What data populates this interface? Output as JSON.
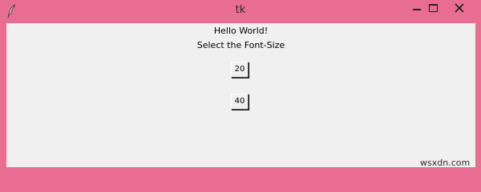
{
  "window": {
    "title": "tk"
  },
  "labels": {
    "greeting": "Hello World!",
    "prompt": "Select the Font-Size"
  },
  "buttons": {
    "size_20": "20",
    "size_40": "40"
  },
  "watermark": "wsxdn.com",
  "colors": {
    "frame": "#e96c93",
    "client_bg": "#f0f0f0"
  },
  "icons": {
    "app": "feather-icon",
    "minimize": "minimize-icon",
    "maximize": "maximize-icon",
    "close": "close-icon"
  }
}
